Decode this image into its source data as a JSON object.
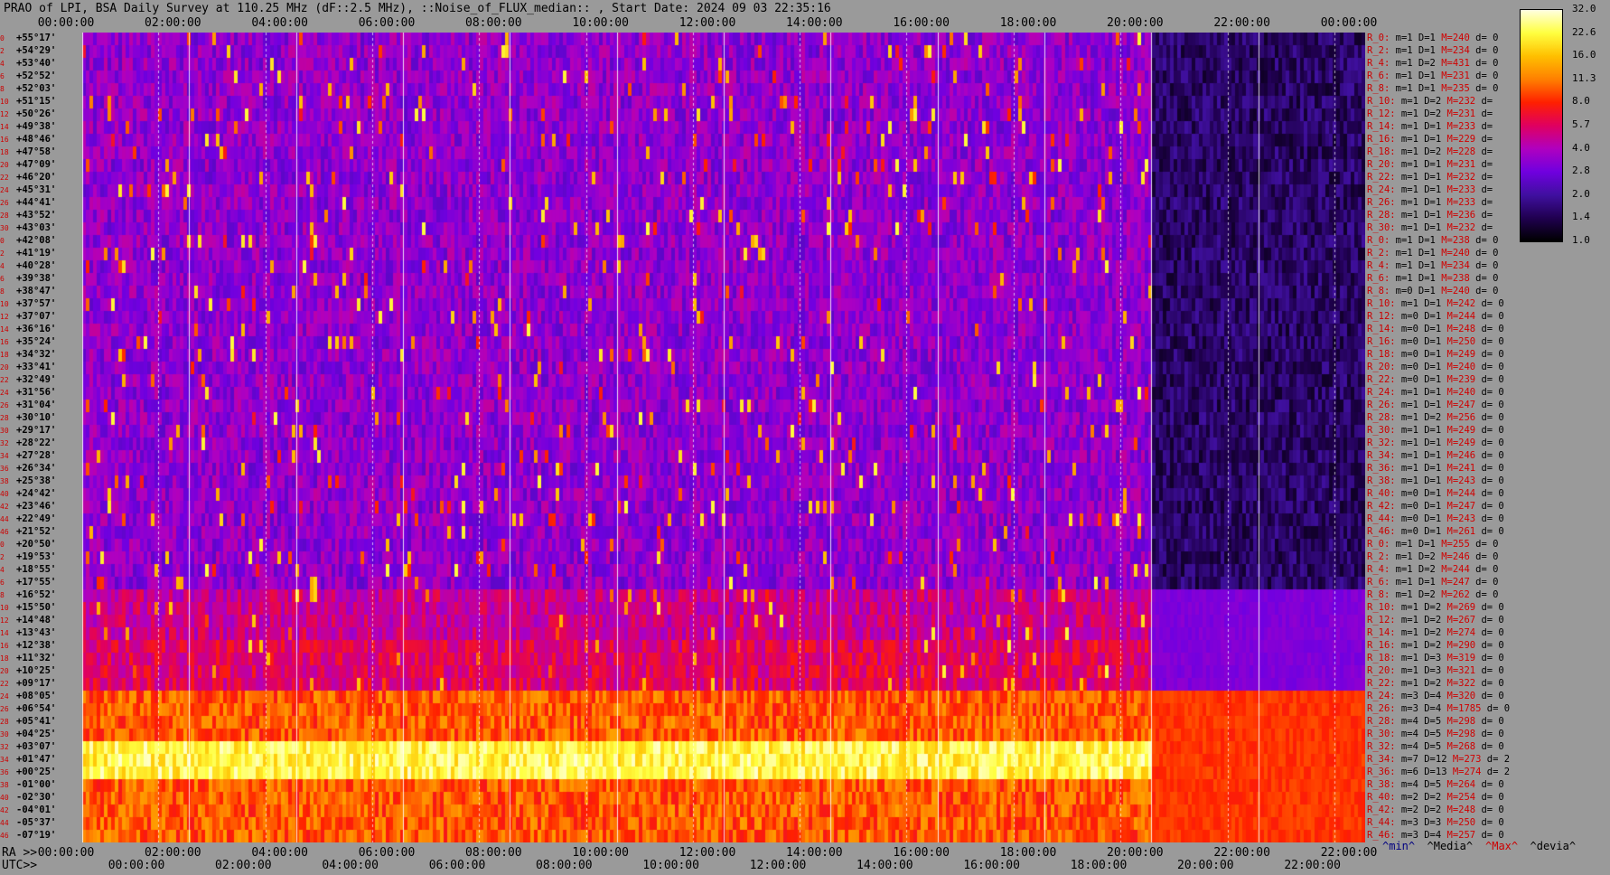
{
  "title": "PRAO of LPI, BSA Daily Survey at 110.25 MHz (dF::2.5 MHz), ::Noise_of_FLUX_median:: , Start Date: 2024 09 03 22:35:16",
  "top_times": [
    "00:00:00",
    "02:00:00",
    "04:00:00",
    "06:00:00",
    "08:00:00",
    "10:00:00",
    "12:00:00",
    "14:00:00",
    "16:00:00",
    "18:00:00",
    "20:00:00",
    "22:00:00",
    "00:00:00"
  ],
  "bottom_ra_label": "RA >>",
  "bottom_ra_times": [
    "00:00:00",
    "02:00:00",
    "04:00:00",
    "06:00:00",
    "08:00:00",
    "10:00:00",
    "12:00:00",
    "14:00:00",
    "16:00:00",
    "18:00:00",
    "20:00:00",
    "22:00:00",
    "22:00:00"
  ],
  "bottom_utc_label": "UTC>>",
  "bottom_utc_times": [
    "00:00:00",
    "02:00:00",
    "04:00:00",
    "06:00:00",
    "08:00:00",
    "10:00:00",
    "12:00:00",
    "14:00:00",
    "16:00:00",
    "18:00:00",
    "20:00:00",
    "22:00:00"
  ],
  "legend_selectors": [
    {
      "text": "^min^",
      "color": "#000080"
    },
    {
      "text": "^Media^",
      "color": "#000000"
    },
    {
      "text": "^Max^",
      "color": "#cc0000"
    },
    {
      "text": "^devia^",
      "color": "#000000"
    }
  ],
  "colorbar": {
    "ticks": [
      "32.0",
      "22.6",
      "16.0",
      "11.3",
      "8.0",
      "5.7",
      "4.0",
      "2.8",
      "2.0",
      "1.4",
      "1.0"
    ],
    "colors": [
      "#ffffe0",
      "#ffff40",
      "#ffc000",
      "#ff8000",
      "#ff2000",
      "#e00060",
      "#b000c0",
      "#7000e0",
      "#4010a0",
      "#200050",
      "#000000"
    ]
  },
  "rows": [
    {
      "idx": "0",
      "dec": "+55°17'"
    },
    {
      "idx": "2",
      "dec": "+54°29'"
    },
    {
      "idx": "4",
      "dec": "+53°40'"
    },
    {
      "idx": "6",
      "dec": "+52°52'"
    },
    {
      "idx": "8",
      "dec": "+52°03'"
    },
    {
      "idx": "10",
      "dec": "+51°15'"
    },
    {
      "idx": "12",
      "dec": "+50°26'"
    },
    {
      "idx": "14",
      "dec": "+49°38'"
    },
    {
      "idx": "16",
      "dec": "+48°46'"
    },
    {
      "idx": "18",
      "dec": "+47°58'"
    },
    {
      "idx": "20",
      "dec": "+47°09'"
    },
    {
      "idx": "22",
      "dec": "+46°20'"
    },
    {
      "idx": "24",
      "dec": "+45°31'"
    },
    {
      "idx": "26",
      "dec": "+44°41'"
    },
    {
      "idx": "28",
      "dec": "+43°52'"
    },
    {
      "idx": "30",
      "dec": "+43°03'"
    },
    {
      "idx": "0",
      "dec": "+42°08'"
    },
    {
      "idx": "2",
      "dec": "+41°19'"
    },
    {
      "idx": "4",
      "dec": "+40°28'"
    },
    {
      "idx": "6",
      "dec": "+39°38'"
    },
    {
      "idx": "8",
      "dec": "+38°47'"
    },
    {
      "idx": "10",
      "dec": "+37°57'"
    },
    {
      "idx": "12",
      "dec": "+37°07'"
    },
    {
      "idx": "14",
      "dec": "+36°16'"
    },
    {
      "idx": "16",
      "dec": "+35°24'"
    },
    {
      "idx": "18",
      "dec": "+34°32'"
    },
    {
      "idx": "20",
      "dec": "+33°41'"
    },
    {
      "idx": "22",
      "dec": "+32°49'"
    },
    {
      "idx": "24",
      "dec": "+31°56'"
    },
    {
      "idx": "26",
      "dec": "+31°04'"
    },
    {
      "idx": "28",
      "dec": "+30°10'"
    },
    {
      "idx": "30",
      "dec": "+29°17'"
    },
    {
      "idx": "32",
      "dec": "+28°22'"
    },
    {
      "idx": "34",
      "dec": "+27°28'"
    },
    {
      "idx": "36",
      "dec": "+26°34'"
    },
    {
      "idx": "38",
      "dec": "+25°38'"
    },
    {
      "idx": "40",
      "dec": "+24°42'"
    },
    {
      "idx": "42",
      "dec": "+23°46'"
    },
    {
      "idx": "44",
      "dec": "+22°49'"
    },
    {
      "idx": "46",
      "dec": "+21°52'"
    },
    {
      "idx": "0",
      "dec": "+20°50'"
    },
    {
      "idx": "2",
      "dec": "+19°53'"
    },
    {
      "idx": "4",
      "dec": "+18°55'"
    },
    {
      "idx": "6",
      "dec": "+17°55'"
    },
    {
      "idx": "8",
      "dec": "+16°52'"
    },
    {
      "idx": "10",
      "dec": "+15°50'"
    },
    {
      "idx": "12",
      "dec": "+14°48'"
    },
    {
      "idx": "14",
      "dec": "+13°43'"
    },
    {
      "idx": "16",
      "dec": "+12°38'"
    },
    {
      "idx": "18",
      "dec": "+11°32'"
    },
    {
      "idx": "20",
      "dec": "+10°25'"
    },
    {
      "idx": "22",
      "dec": "+09°17'"
    },
    {
      "idx": "24",
      "dec": "+08°05'"
    },
    {
      "idx": "26",
      "dec": "+06°54'"
    },
    {
      "idx": "28",
      "dec": "+05°41'"
    },
    {
      "idx": "30",
      "dec": "+04°25'"
    },
    {
      "idx": "32",
      "dec": "+03°07'"
    },
    {
      "idx": "34",
      "dec": "+01°47'"
    },
    {
      "idx": "36",
      "dec": "+00°25'"
    },
    {
      "idx": "38",
      "dec": "-01°00'"
    },
    {
      "idx": "40",
      "dec": "-02°30'"
    },
    {
      "idx": "42",
      "dec": "-04°01'"
    },
    {
      "idx": "44",
      "dec": "-05°37'"
    },
    {
      "idx": "46",
      "dec": "-07°19'"
    }
  ],
  "stats": [
    {
      "r": "R_0:",
      "m": "m=1",
      "D": "D=1",
      "M": "M=240",
      "d": "d= 0"
    },
    {
      "r": "R_2:",
      "m": "m=1",
      "D": "D=1",
      "M": "M=234",
      "d": "d= 0"
    },
    {
      "r": "R_4:",
      "m": "m=1",
      "D": "D=2",
      "M": "M=431",
      "d": "d= 0"
    },
    {
      "r": "R_6:",
      "m": "m=1",
      "D": "D=1",
      "M": "M=231",
      "d": "d= 0"
    },
    {
      "r": "R_8:",
      "m": "m=1",
      "D": "D=1",
      "M": "M=235",
      "d": "d= 0"
    },
    {
      "r": "R_10:",
      "m": "m=1",
      "D": "D=2",
      "M": "M=232",
      "d": "d="
    },
    {
      "r": "R_12:",
      "m": "m=1",
      "D": "D=2",
      "M": "M=231",
      "d": "d="
    },
    {
      "r": "R_14:",
      "m": "m=1",
      "D": "D=1",
      "M": "M=233",
      "d": "d="
    },
    {
      "r": "R_16:",
      "m": "m=1",
      "D": "D=1",
      "M": "M=229",
      "d": "d="
    },
    {
      "r": "R_18:",
      "m": "m=1",
      "D": "D=2",
      "M": "M=228",
      "d": "d="
    },
    {
      "r": "R_20:",
      "m": "m=1",
      "D": "D=1",
      "M": "M=231",
      "d": "d="
    },
    {
      "r": "R_22:",
      "m": "m=1",
      "D": "D=1",
      "M": "M=232",
      "d": "d="
    },
    {
      "r": "R_24:",
      "m": "m=1",
      "D": "D=1",
      "M": "M=233",
      "d": "d="
    },
    {
      "r": "R_26:",
      "m": "m=1",
      "D": "D=1",
      "M": "M=233",
      "d": "d="
    },
    {
      "r": "R_28:",
      "m": "m=1",
      "D": "D=1",
      "M": "M=236",
      "d": "d="
    },
    {
      "r": "R_30:",
      "m": "m=1",
      "D": "D=1",
      "M": "M=232",
      "d": "d="
    },
    {
      "r": "R_0:",
      "m": "m=1",
      "D": "D=1",
      "M": "M=238",
      "d": "d= 0"
    },
    {
      "r": "R_2:",
      "m": "m=1",
      "D": "D=1",
      "M": "M=240",
      "d": "d= 0"
    },
    {
      "r": "R_4:",
      "m": "m=1",
      "D": "D=1",
      "M": "M=234",
      "d": "d= 0"
    },
    {
      "r": "R_6:",
      "m": "m=1",
      "D": "D=1",
      "M": "M=238",
      "d": "d= 0"
    },
    {
      "r": "R_8:",
      "m": "m=0",
      "D": "D=1",
      "M": "M=240",
      "d": "d= 0"
    },
    {
      "r": "R_10:",
      "m": "m=1",
      "D": "D=1",
      "M": "M=242",
      "d": "d= 0"
    },
    {
      "r": "R_12:",
      "m": "m=0",
      "D": "D=1",
      "M": "M=244",
      "d": "d= 0"
    },
    {
      "r": "R_14:",
      "m": "m=0",
      "D": "D=1",
      "M": "M=248",
      "d": "d= 0"
    },
    {
      "r": "R_16:",
      "m": "m=0",
      "D": "D=1",
      "M": "M=250",
      "d": "d= 0"
    },
    {
      "r": "R_18:",
      "m": "m=0",
      "D": "D=1",
      "M": "M=249",
      "d": "d= 0"
    },
    {
      "r": "R_20:",
      "m": "m=0",
      "D": "D=1",
      "M": "M=240",
      "d": "d= 0"
    },
    {
      "r": "R_22:",
      "m": "m=0",
      "D": "D=1",
      "M": "M=239",
      "d": "d= 0"
    },
    {
      "r": "R_24:",
      "m": "m=1",
      "D": "D=1",
      "M": "M=240",
      "d": "d= 0"
    },
    {
      "r": "R_26:",
      "m": "m=1",
      "D": "D=1",
      "M": "M=247",
      "d": "d= 0"
    },
    {
      "r": "R_28:",
      "m": "m=1",
      "D": "D=2",
      "M": "M=256",
      "d": "d= 0"
    },
    {
      "r": "R_30:",
      "m": "m=1",
      "D": "D=1",
      "M": "M=249",
      "d": "d= 0"
    },
    {
      "r": "R_32:",
      "m": "m=1",
      "D": "D=1",
      "M": "M=249",
      "d": "d= 0"
    },
    {
      "r": "R_34:",
      "m": "m=1",
      "D": "D=1",
      "M": "M=246",
      "d": "d= 0"
    },
    {
      "r": "R_36:",
      "m": "m=1",
      "D": "D=1",
      "M": "M=241",
      "d": "d= 0"
    },
    {
      "r": "R_38:",
      "m": "m=1",
      "D": "D=1",
      "M": "M=243",
      "d": "d= 0"
    },
    {
      "r": "R_40:",
      "m": "m=0",
      "D": "D=1",
      "M": "M=244",
      "d": "d= 0"
    },
    {
      "r": "R_42:",
      "m": "m=0",
      "D": "D=1",
      "M": "M=247",
      "d": "d= 0"
    },
    {
      "r": "R_44:",
      "m": "m=0",
      "D": "D=1",
      "M": "M=243",
      "d": "d= 0"
    },
    {
      "r": "R_46:",
      "m": "m=0",
      "D": "D=1",
      "M": "M=261",
      "d": "d= 0"
    },
    {
      "r": "R_0:",
      "m": "m=1",
      "D": "D=1",
      "M": "M=255",
      "d": "d= 0"
    },
    {
      "r": "R_2:",
      "m": "m=1",
      "D": "D=2",
      "M": "M=246",
      "d": "d= 0"
    },
    {
      "r": "R_4:",
      "m": "m=1",
      "D": "D=2",
      "M": "M=244",
      "d": "d= 0"
    },
    {
      "r": "R_6:",
      "m": "m=1",
      "D": "D=1",
      "M": "M=247",
      "d": "d= 0"
    },
    {
      "r": "R_8:",
      "m": "m=1",
      "D": "D=2",
      "M": "M=262",
      "d": "d= 0"
    },
    {
      "r": "R_10:",
      "m": "m=1",
      "D": "D=2",
      "M": "M=269",
      "d": "d= 0"
    },
    {
      "r": "R_12:",
      "m": "m=1",
      "D": "D=2",
      "M": "M=267",
      "d": "d= 0"
    },
    {
      "r": "R_14:",
      "m": "m=1",
      "D": "D=2",
      "M": "M=274",
      "d": "d= 0"
    },
    {
      "r": "R_16:",
      "m": "m=1",
      "D": "D=2",
      "M": "M=290",
      "d": "d= 0"
    },
    {
      "r": "R_18:",
      "m": "m=1",
      "D": "D=3",
      "M": "M=319",
      "d": "d= 0"
    },
    {
      "r": "R_20:",
      "m": "m=1",
      "D": "D=3",
      "M": "M=321",
      "d": "d= 0"
    },
    {
      "r": "R_22:",
      "m": "m=1",
      "D": "D=2",
      "M": "M=322",
      "d": "d= 0"
    },
    {
      "r": "R_24:",
      "m": "m=3",
      "D": "D=4",
      "M": "M=320",
      "d": "d= 0"
    },
    {
      "r": "R_26:",
      "m": "m=3",
      "D": "D=4",
      "M": "M=1785",
      "d": "d= 0"
    },
    {
      "r": "R_28:",
      "m": "m=4",
      "D": "D=5",
      "M": "M=298",
      "d": "d= 0"
    },
    {
      "r": "R_30:",
      "m": "m=4",
      "D": "D=5",
      "M": "M=298",
      "d": "d= 0"
    },
    {
      "r": "R_32:",
      "m": "m=4",
      "D": "D=5",
      "M": "M=268",
      "d": "d= 0"
    },
    {
      "r": "R_34:",
      "m": "m=7",
      "D": "D=12",
      "M": "M=273",
      "d": "d= 2"
    },
    {
      "r": "R_36:",
      "m": "m=6",
      "D": "D=13",
      "M": "M=274",
      "d": "d= 2"
    },
    {
      "r": "R_38:",
      "m": "m=4",
      "D": "D=5",
      "M": "M=264",
      "d": "d= 0"
    },
    {
      "r": "R_40:",
      "m": "m=2",
      "D": "D=2",
      "M": "M=254",
      "d": "d= 0"
    },
    {
      "r": "R_42:",
      "m": "m=2",
      "D": "D=2",
      "M": "M=248",
      "d": "d= 0"
    },
    {
      "r": "R_44:",
      "m": "m=3",
      "D": "D=3",
      "M": "M=250",
      "d": "d= 0"
    },
    {
      "r": "R_46:",
      "m": "m=3",
      "D": "D=4",
      "M": "M=257",
      "d": "d= 0"
    }
  ],
  "chart_data": {
    "type": "heatmap",
    "title": "PRAO of LPI, BSA Daily Survey at 110.25 MHz (dF::2.5 MHz), ::Noise_of_FLUX_median:: , Start Date: 2024 09 03 22:35:16",
    "x_axis": [
      "00:00:00",
      "02:00:00",
      "04:00:00",
      "06:00:00",
      "08:00:00",
      "10:00:00",
      "12:00:00",
      "14:00:00",
      "16:00:00",
      "18:00:00",
      "20:00:00",
      "22:00:00",
      "00:00:00"
    ],
    "y_axis_count": 64,
    "color_scale": [
      32.0,
      22.6,
      16.0,
      11.3,
      8.0,
      5.7,
      4.0,
      2.8,
      2.0,
      1.4,
      1.0
    ],
    "features": {
      "bright_band_rows": [
        56,
        57,
        58
      ],
      "warm_band_rows": [
        52,
        53,
        54,
        55,
        59,
        60,
        61,
        62,
        63
      ],
      "data_gap_after_utc": "20:00:00"
    }
  }
}
